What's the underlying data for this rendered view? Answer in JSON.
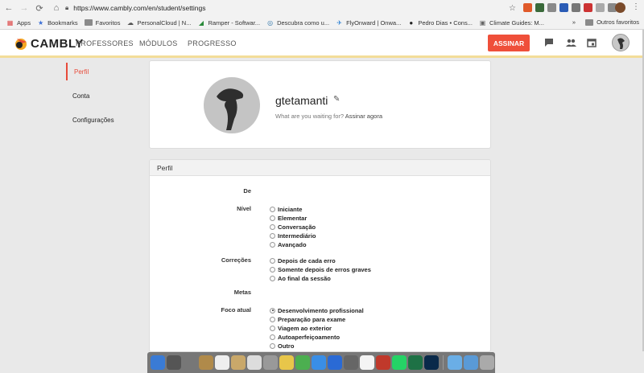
{
  "browser": {
    "url": "https://www.cambly.com/en/student/settings",
    "back_icon": "arrow-left-icon",
    "forward_icon": "arrow-right-icon",
    "reload_icon": "reload-icon",
    "bookmarks": [
      {
        "label": "Apps",
        "icon": "apps-grid-icon",
        "color": "#d44"
      },
      {
        "label": "Bookmarks",
        "icon": "star-icon",
        "color": "#3b6fd6"
      },
      {
        "label": "Favoritos",
        "icon": "folder-icon",
        "color": "#888"
      },
      {
        "label": "PersonalCloud | N...",
        "icon": "cloud-icon",
        "color": "#555"
      },
      {
        "label": "Ramper - Softwar...",
        "icon": "ramper-icon",
        "color": "#2a8a3a"
      },
      {
        "label": "Descubra como u...",
        "icon": "globe-icon",
        "color": "#37a"
      },
      {
        "label": "FlyOnward | Onwa...",
        "icon": "plane-icon",
        "color": "#2a7fd4"
      },
      {
        "label": "Pedro Dias • Cons...",
        "icon": "medium-icon",
        "color": "#222"
      },
      {
        "label": "Climate Guides: M...",
        "icon": "climate-icon",
        "color": "#666"
      }
    ],
    "overflow": "»",
    "other_bookmarks": "Outros favoritos"
  },
  "header": {
    "logo": "CAMBLY",
    "nav": [
      "PROFESSORES",
      "MÓDULOS",
      "PROGRESSO"
    ],
    "cta": "ASSINAR",
    "colors": {
      "accent": "#ef4f3a",
      "header_border": "#f3dd99"
    }
  },
  "subnav": {
    "items": [
      {
        "label": "Perfil",
        "active": true
      },
      {
        "label": "Conta",
        "active": false
      },
      {
        "label": "Configurações",
        "active": false
      }
    ]
  },
  "profile": {
    "username": "gtetamanti",
    "promo_text": "What are you waiting for?",
    "promo_link": "Assinar agora"
  },
  "form": {
    "title": "Perfil",
    "de_label": "De",
    "nivel_label": "Nível",
    "nivel_options": [
      "Iniciante",
      "Elementar",
      "Conversação",
      "Intermediário",
      "Avançado"
    ],
    "correcoes_label": "Correções",
    "correcoes_options": [
      "Depois de cada erro",
      "Somente depois de erros graves",
      "Ao final da sessão"
    ],
    "metas_label": "Metas",
    "foco_label": "Foco atual",
    "foco_options": [
      "Desenvolvimento profissional",
      "Preparação para exame",
      "Viagem ao exterior",
      "Autoaperfeiçoamento",
      "Outro"
    ],
    "foco_selected": "Desenvolvimento profissional"
  }
}
